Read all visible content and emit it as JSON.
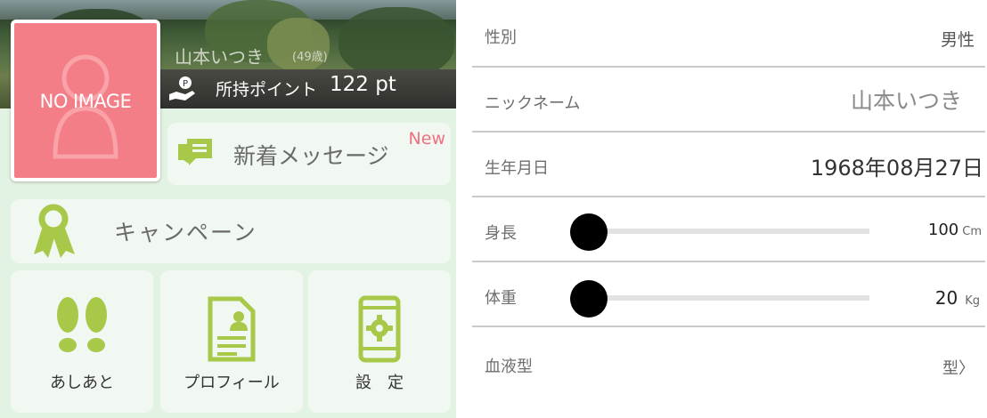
{
  "profile": {
    "name": "山本いつき",
    "age": "(49歳)",
    "photo_placeholder": "NO IMAGE",
    "points_label": "所持ポイント",
    "points_value": "122 pt"
  },
  "menu": {
    "messages_label": "新着メッセージ",
    "messages_badge": "New",
    "campaign_label": "キャンペーン",
    "tiles": [
      {
        "label": "あしあと",
        "icon": "footprints-icon"
      },
      {
        "label": "プロフィール",
        "icon": "profile-document-icon"
      },
      {
        "label": "設　定",
        "icon": "settings-phone-icon"
      }
    ]
  },
  "details": {
    "gender": {
      "label": "性別",
      "value": "男性"
    },
    "nickname": {
      "label": "ニックネーム",
      "value": "山本いつき"
    },
    "birthday": {
      "label": "生年月日",
      "value": "1968年08月27日"
    },
    "height": {
      "label": "身長",
      "value": "100",
      "unit": "Cm",
      "slider_fraction": 0.0
    },
    "weight": {
      "label": "体重",
      "value": "20",
      "unit": "Kg",
      "slider_fraction": 0.0
    },
    "blood_type": {
      "label": "血液型",
      "value": "型〉"
    }
  },
  "colors": {
    "panel_bg": "#e3f3e3",
    "card_bg": "#f1f8f1",
    "accent_green": "#a8c84a",
    "photo_pink": "#f47e87",
    "badge_pink": "#f07080",
    "divider": "#c9c9c9"
  }
}
